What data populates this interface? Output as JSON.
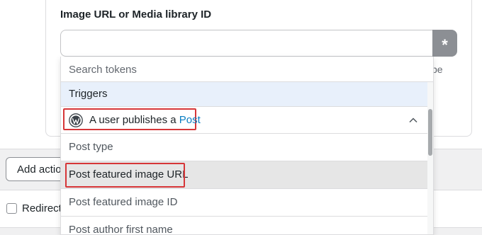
{
  "field": {
    "label": "Image URL or Media library ID",
    "value": "",
    "token_button_label": "*",
    "helper_fragment": "pe"
  },
  "add_action": {
    "label": "Add actio"
  },
  "redirect": {
    "label": "Redirect",
    "checked": false
  },
  "dropdown": {
    "search_placeholder": "Search tokens",
    "group_header": "Triggers",
    "trigger": {
      "icon": "wordpress-icon",
      "prefix": "A user publishes a ",
      "accent": "Post",
      "accent_color": "#0a7ec2",
      "expand_icon": "chevron-up-icon"
    },
    "items": [
      {
        "label": "Post type"
      },
      {
        "label": "Post featured image URL",
        "hovered": true
      },
      {
        "label": "Post featured image ID"
      },
      {
        "label": "Post author first name"
      }
    ]
  },
  "colors": {
    "highlight_box": "#d63638",
    "group_header_bg": "#e8f0fb",
    "token_button_bg": "#8c8f94"
  }
}
